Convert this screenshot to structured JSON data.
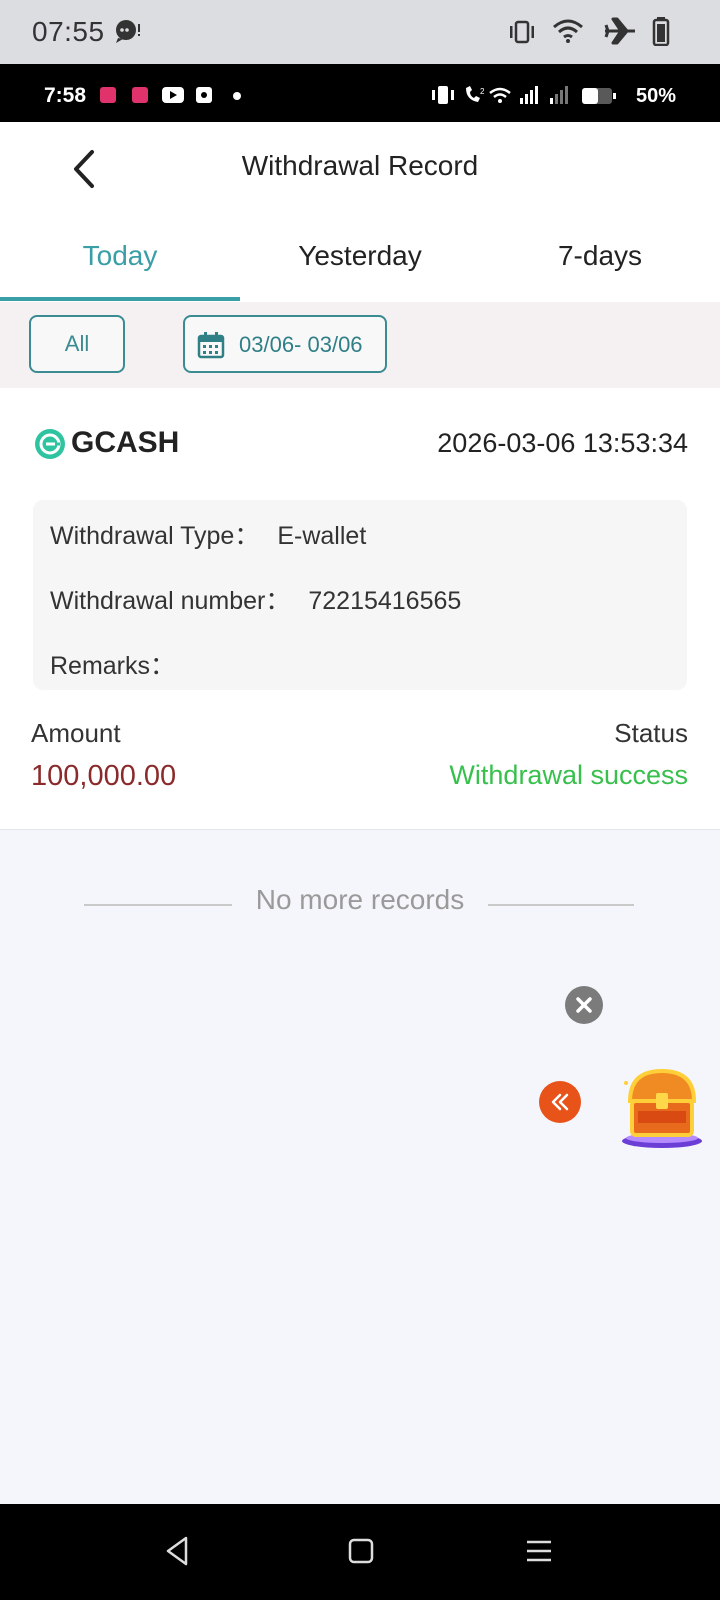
{
  "outer_status": {
    "time": "07:55",
    "icons": [
      "chat-bubble-icon",
      "vibrate-icon",
      "wifi-icon",
      "airplane-icon",
      "battery-icon"
    ]
  },
  "inner_status": {
    "time": "7:58",
    "battery": "50%",
    "icons": [
      "app-notification-icon",
      "youtube-icon",
      "dot-icon",
      "vibrate-icon",
      "volte-icon",
      "wifi-icon",
      "signal-icon",
      "battery-icon"
    ]
  },
  "header": {
    "title": "Withdrawal Record"
  },
  "tabs": [
    {
      "label": "Today",
      "active": true
    },
    {
      "label": "Yesterday",
      "active": false
    },
    {
      "label": "7-days",
      "active": false
    }
  ],
  "filters": {
    "all_label": "All",
    "date_range": "03/06- 03/06"
  },
  "record": {
    "method": "GCASH",
    "datetime": "2026-03-06 13:53:34",
    "type_label": "Withdrawal Type：",
    "type_value": "E-wallet",
    "number_label": "Withdrawal number：",
    "number_value": "72215416565",
    "remarks_label": "Remarks：",
    "remarks_value": "",
    "amount_label": "Amount",
    "amount_value": "100,000.00",
    "status_label": "Status",
    "status_value": "Withdrawal success"
  },
  "list_end_text": "No more records",
  "colors": {
    "accent": "#3a9ea6",
    "amount": "#8b2a2a",
    "success": "#37c04b",
    "gcash": "#2ec4a0"
  }
}
